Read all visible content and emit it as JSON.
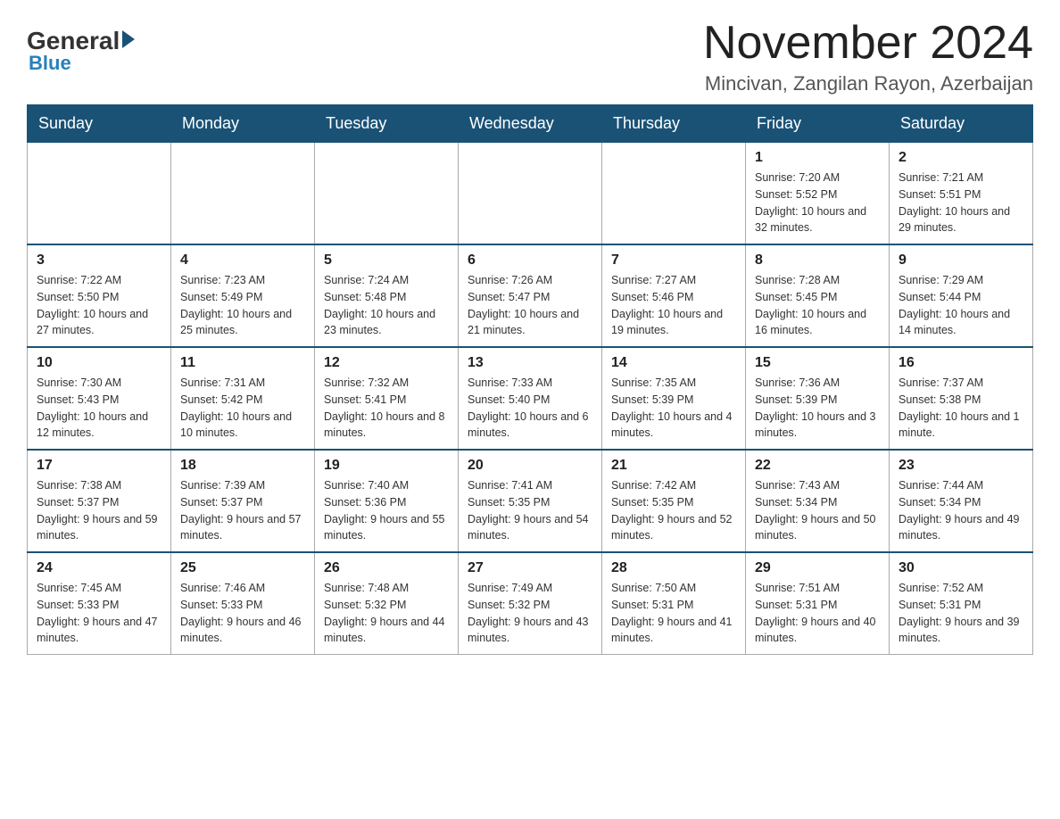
{
  "header": {
    "logo_general": "General",
    "logo_blue": "Blue",
    "month_title": "November 2024",
    "location": "Mincivan, Zangilan Rayon, Azerbaijan"
  },
  "weekdays": [
    "Sunday",
    "Monday",
    "Tuesday",
    "Wednesday",
    "Thursday",
    "Friday",
    "Saturday"
  ],
  "weeks": [
    [
      {
        "day": "",
        "sunrise": "",
        "sunset": "",
        "daylight": ""
      },
      {
        "day": "",
        "sunrise": "",
        "sunset": "",
        "daylight": ""
      },
      {
        "day": "",
        "sunrise": "",
        "sunset": "",
        "daylight": ""
      },
      {
        "day": "",
        "sunrise": "",
        "sunset": "",
        "daylight": ""
      },
      {
        "day": "",
        "sunrise": "",
        "sunset": "",
        "daylight": ""
      },
      {
        "day": "1",
        "sunrise": "Sunrise: 7:20 AM",
        "sunset": "Sunset: 5:52 PM",
        "daylight": "Daylight: 10 hours and 32 minutes."
      },
      {
        "day": "2",
        "sunrise": "Sunrise: 7:21 AM",
        "sunset": "Sunset: 5:51 PM",
        "daylight": "Daylight: 10 hours and 29 minutes."
      }
    ],
    [
      {
        "day": "3",
        "sunrise": "Sunrise: 7:22 AM",
        "sunset": "Sunset: 5:50 PM",
        "daylight": "Daylight: 10 hours and 27 minutes."
      },
      {
        "day": "4",
        "sunrise": "Sunrise: 7:23 AM",
        "sunset": "Sunset: 5:49 PM",
        "daylight": "Daylight: 10 hours and 25 minutes."
      },
      {
        "day": "5",
        "sunrise": "Sunrise: 7:24 AM",
        "sunset": "Sunset: 5:48 PM",
        "daylight": "Daylight: 10 hours and 23 minutes."
      },
      {
        "day": "6",
        "sunrise": "Sunrise: 7:26 AM",
        "sunset": "Sunset: 5:47 PM",
        "daylight": "Daylight: 10 hours and 21 minutes."
      },
      {
        "day": "7",
        "sunrise": "Sunrise: 7:27 AM",
        "sunset": "Sunset: 5:46 PM",
        "daylight": "Daylight: 10 hours and 19 minutes."
      },
      {
        "day": "8",
        "sunrise": "Sunrise: 7:28 AM",
        "sunset": "Sunset: 5:45 PM",
        "daylight": "Daylight: 10 hours and 16 minutes."
      },
      {
        "day": "9",
        "sunrise": "Sunrise: 7:29 AM",
        "sunset": "Sunset: 5:44 PM",
        "daylight": "Daylight: 10 hours and 14 minutes."
      }
    ],
    [
      {
        "day": "10",
        "sunrise": "Sunrise: 7:30 AM",
        "sunset": "Sunset: 5:43 PM",
        "daylight": "Daylight: 10 hours and 12 minutes."
      },
      {
        "day": "11",
        "sunrise": "Sunrise: 7:31 AM",
        "sunset": "Sunset: 5:42 PM",
        "daylight": "Daylight: 10 hours and 10 minutes."
      },
      {
        "day": "12",
        "sunrise": "Sunrise: 7:32 AM",
        "sunset": "Sunset: 5:41 PM",
        "daylight": "Daylight: 10 hours and 8 minutes."
      },
      {
        "day": "13",
        "sunrise": "Sunrise: 7:33 AM",
        "sunset": "Sunset: 5:40 PM",
        "daylight": "Daylight: 10 hours and 6 minutes."
      },
      {
        "day": "14",
        "sunrise": "Sunrise: 7:35 AM",
        "sunset": "Sunset: 5:39 PM",
        "daylight": "Daylight: 10 hours and 4 minutes."
      },
      {
        "day": "15",
        "sunrise": "Sunrise: 7:36 AM",
        "sunset": "Sunset: 5:39 PM",
        "daylight": "Daylight: 10 hours and 3 minutes."
      },
      {
        "day": "16",
        "sunrise": "Sunrise: 7:37 AM",
        "sunset": "Sunset: 5:38 PM",
        "daylight": "Daylight: 10 hours and 1 minute."
      }
    ],
    [
      {
        "day": "17",
        "sunrise": "Sunrise: 7:38 AM",
        "sunset": "Sunset: 5:37 PM",
        "daylight": "Daylight: 9 hours and 59 minutes."
      },
      {
        "day": "18",
        "sunrise": "Sunrise: 7:39 AM",
        "sunset": "Sunset: 5:37 PM",
        "daylight": "Daylight: 9 hours and 57 minutes."
      },
      {
        "day": "19",
        "sunrise": "Sunrise: 7:40 AM",
        "sunset": "Sunset: 5:36 PM",
        "daylight": "Daylight: 9 hours and 55 minutes."
      },
      {
        "day": "20",
        "sunrise": "Sunrise: 7:41 AM",
        "sunset": "Sunset: 5:35 PM",
        "daylight": "Daylight: 9 hours and 54 minutes."
      },
      {
        "day": "21",
        "sunrise": "Sunrise: 7:42 AM",
        "sunset": "Sunset: 5:35 PM",
        "daylight": "Daylight: 9 hours and 52 minutes."
      },
      {
        "day": "22",
        "sunrise": "Sunrise: 7:43 AM",
        "sunset": "Sunset: 5:34 PM",
        "daylight": "Daylight: 9 hours and 50 minutes."
      },
      {
        "day": "23",
        "sunrise": "Sunrise: 7:44 AM",
        "sunset": "Sunset: 5:34 PM",
        "daylight": "Daylight: 9 hours and 49 minutes."
      }
    ],
    [
      {
        "day": "24",
        "sunrise": "Sunrise: 7:45 AM",
        "sunset": "Sunset: 5:33 PM",
        "daylight": "Daylight: 9 hours and 47 minutes."
      },
      {
        "day": "25",
        "sunrise": "Sunrise: 7:46 AM",
        "sunset": "Sunset: 5:33 PM",
        "daylight": "Daylight: 9 hours and 46 minutes."
      },
      {
        "day": "26",
        "sunrise": "Sunrise: 7:48 AM",
        "sunset": "Sunset: 5:32 PM",
        "daylight": "Daylight: 9 hours and 44 minutes."
      },
      {
        "day": "27",
        "sunrise": "Sunrise: 7:49 AM",
        "sunset": "Sunset: 5:32 PM",
        "daylight": "Daylight: 9 hours and 43 minutes."
      },
      {
        "day": "28",
        "sunrise": "Sunrise: 7:50 AM",
        "sunset": "Sunset: 5:31 PM",
        "daylight": "Daylight: 9 hours and 41 minutes."
      },
      {
        "day": "29",
        "sunrise": "Sunrise: 7:51 AM",
        "sunset": "Sunset: 5:31 PM",
        "daylight": "Daylight: 9 hours and 40 minutes."
      },
      {
        "day": "30",
        "sunrise": "Sunrise: 7:52 AM",
        "sunset": "Sunset: 5:31 PM",
        "daylight": "Daylight: 9 hours and 39 minutes."
      }
    ]
  ]
}
